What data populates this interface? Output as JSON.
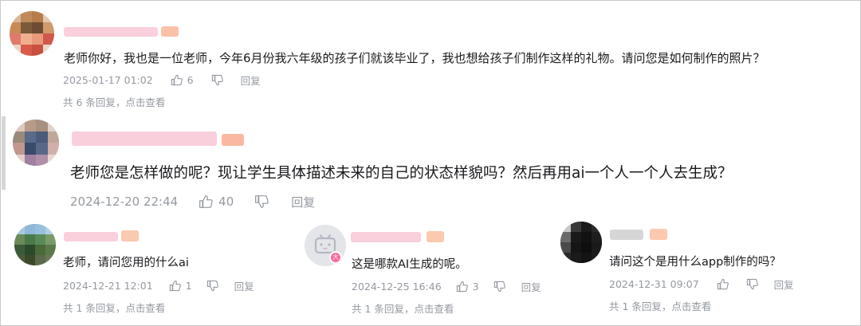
{
  "comments": [
    {
      "text": "老师你好，我也是一位老师，今年6月份我六年级的孩子们就该毕业了，我也想给孩子们制作这样的礼物。请问您是如何制作的照片？",
      "time": "2025-01-17 01:02",
      "likes": "6",
      "reply_label": "回复",
      "replies_summary": "共 6 条回复，点击查看"
    },
    {
      "text": "老师您是怎样做的呢？现让学生具体描述未来的自己的状态样貌吗？然后再用ai一个人一个人去生成？",
      "time": "2024-12-20 22:44",
      "likes": "40",
      "reply_label": "回复"
    },
    {
      "text": "老师，请问您用的什么ai",
      "time": "2024-12-21 12:01",
      "likes": "1",
      "reply_label": "回复",
      "replies_summary": "共 1 条回复，点击查看"
    },
    {
      "text": "这是哪款AI生成的呢。",
      "time": "2024-12-25 16:46",
      "likes": "3",
      "reply_label": "回复",
      "replies_summary": "共 1 条回复，点击查看"
    },
    {
      "text": "请问这个是用什么app制作的吗？",
      "time": "2024-12-31 09:07",
      "reply_label": "回复",
      "replies_summary": "共 1 条回复，点击查看"
    }
  ],
  "colors": {
    "text": "#18191c",
    "meta": "#9499a0",
    "name_blur": "#f9c9d6",
    "badge_blur": "#fbb8a0",
    "divider": "#d6d6d6"
  }
}
